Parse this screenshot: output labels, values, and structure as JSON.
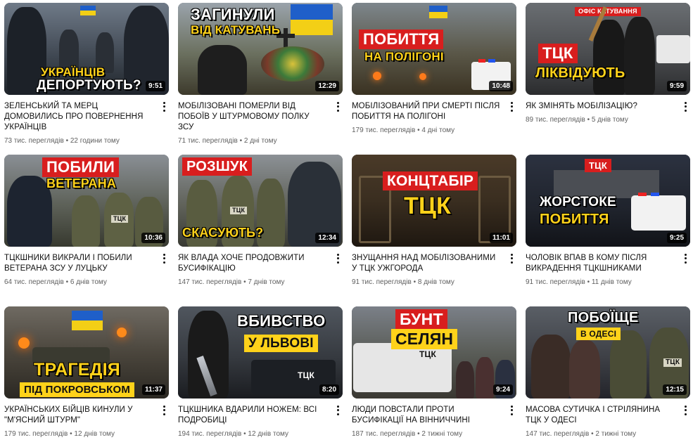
{
  "videos": [
    {
      "title": "Зеленський та Мерц домовились про повернення українців",
      "views": "73 тис. переглядів",
      "age": "22 години тому",
      "duration": "9:51",
      "cap1": "УКРАЇНЦІВ",
      "cap2": "ДЕПОРТУЮТЬ?"
    },
    {
      "title": "Мобілізовані померли від побоїв у штурмовому полку ЗСУ",
      "views": "71 тис. переглядів",
      "age": "2 дні тому",
      "duration": "12:29",
      "cap1": "ЗАГИНУЛИ",
      "cap2": "ВІД КАТУВАНЬ"
    },
    {
      "title": "Мобілізований при смерті після побиття на полігоні",
      "views": "179 тис. переглядів",
      "age": "4 дні тому",
      "duration": "10:48",
      "cap1": "ПОБИТТЯ",
      "cap2": "НА ПОЛІГОНІ"
    },
    {
      "title": "Як змінять мобілізацію?",
      "views": "89 тис. переглядів",
      "age": "5 днів тому",
      "duration": "9:59",
      "cap1": "ТЦК",
      "cap2": "ЛІКВІДУЮТЬ",
      "sign": "ОФІС КАТУВАННЯ"
    },
    {
      "title": "ТЦКшники викрали і побили ветерана ЗСУ у Луцьку",
      "views": "64 тис. переглядів",
      "age": "6 днів тому",
      "duration": "10:36",
      "cap1": "ПОБИЛИ",
      "cap2": "ВЕТЕРАНА",
      "patch": "ТЦК"
    },
    {
      "title": "Як влада хоче продовжити бусифікацію",
      "views": "147 тис. переглядів",
      "age": "7 днів тому",
      "duration": "12:34",
      "cap1": "РОЗШУК",
      "cap2": "СКАСУЮТЬ?",
      "patch": "ТЦК"
    },
    {
      "title": "Знущання над мобілізованими у ТЦК Ужгорода",
      "views": "91 тис. переглядів",
      "age": "8 днів тому",
      "duration": "11:01",
      "cap1": "КОНЦТАБІР",
      "cap2": "ТЦК"
    },
    {
      "title": "Чоловік впав в кому після викрадення ТЦКшниками",
      "views": "91 тис. переглядів",
      "age": "11 днів тому",
      "duration": "9:25",
      "cap1": "ЖОРСТОКЕ",
      "cap2": "ПОБИТТЯ",
      "sign": "ТЦК"
    },
    {
      "title": "Українських бійців кинули у \"м'ясний штурм\"",
      "views": "179 тис. переглядів",
      "age": "12 днів тому",
      "duration": "11:37",
      "cap1": "ТРАГЕДІЯ",
      "cap2": "ПІД ПОКРОВСЬКОМ"
    },
    {
      "title": "ТЦКшника вдарили ножем: всі подробиці",
      "views": "194 тис. переглядів",
      "age": "12 днів тому",
      "duration": "8:20",
      "cap1": "ВБИВСТВО",
      "cap2": "У ЛЬВОВІ",
      "patch": "ТЦК"
    },
    {
      "title": "Люди повстали проти бусифікації на Вінниччині",
      "views": "187 тис. переглядів",
      "age": "2 тижні тому",
      "duration": "9:24",
      "cap1": "БУНТ",
      "cap2": "СЕЛЯН",
      "patch": "ТЦК"
    },
    {
      "title": "Масова сутичка і стрілянина ТЦК у Одесі",
      "views": "147 тис. переглядів",
      "age": "2 тижні тому",
      "duration": "12:15",
      "cap1": "ПОБОЇЩЕ",
      "cap2": "В ОДЕСІ",
      "patch": "ТЦК"
    }
  ],
  "separator": "•",
  "icons": {
    "more": "more-vert-icon"
  },
  "colors": {
    "caption_red": "#d81e1e",
    "caption_yellow": "#ffd21a",
    "ukraine_blue": "#1f5fc9",
    "ukraine_yellow": "#f3cf16"
  }
}
